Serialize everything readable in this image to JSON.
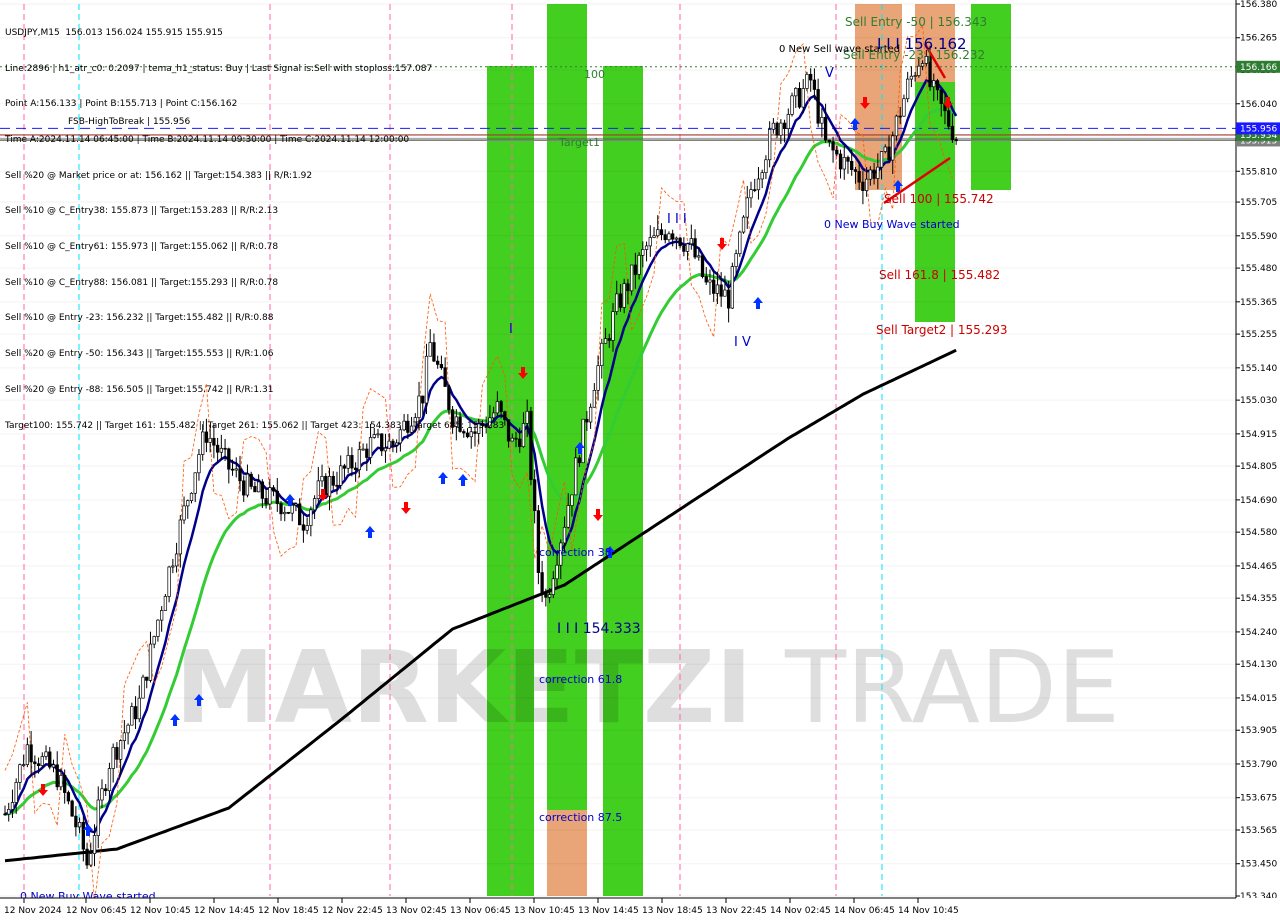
{
  "header": {
    "lines": [
      "USDJPY,M15  156.013 156.024 155.915 155.915",
      "Line:2896 | h1_atr_c0: 0.2097 | tema_h1_status: Buy | Last Signal is:Sell with stoploss:157.087",
      "Point A:156.133 | Point B:155.713 | Point C:156.162",
      "Time A:2024.11.14 06:45:00 | Time B:2024.11.14 09:30:00 | Time C:2024.11.14 12:00:00",
      "Sell %20 @ Market price or at: 156.162 || Target:154.383 || R/R:1.92",
      "Sell %10 @ C_Entry38: 155.873 || Target:153.283 || R/R:2.13",
      "Sell %10 @ C_Entry61: 155.973 || Target:155.062 || R/R:0.78",
      "Sell %10 @ C_Entry88: 156.081 || Target:155.293 || R/R:0.78",
      "Sell %10 @ Entry -23: 156.232 || Target:155.482 || R/R:0.88",
      "Sell %20 @ Entry -50: 156.343 || Target:155.553 || R/R:1.06",
      "Sell %20 @ Entry -88: 156.505 || Target:155.742 || R/R:1.31",
      "Target100: 155.742 || Target 161: 155.482 || Target 261: 155.062 || Target 423: 154.383 || Target 685: 153.283"
    ],
    "overlay": "FSB-HighToBreak | 155.956"
  },
  "watermark": {
    "bold": "MARKETZI",
    "light": "TRADE"
  },
  "chart_data": {
    "type": "candlestick",
    "symbol": "USDJPY",
    "timeframe": "M15",
    "ylim": [
      153.34,
      156.38
    ],
    "y_ticks": [
      "156.380",
      "156.265",
      "156.155",
      "156.040",
      "155.925",
      "155.810",
      "155.705",
      "155.590",
      "155.480",
      "155.365",
      "155.255",
      "155.140",
      "155.030",
      "154.915",
      "154.805",
      "154.690",
      "154.580",
      "154.465",
      "154.355",
      "154.240",
      "154.130",
      "154.015",
      "153.905",
      "153.790",
      "153.675",
      "153.565",
      "153.450",
      "153.340"
    ],
    "x_ticks": [
      "12 Nov 2024",
      "12 Nov 06:45",
      "12 Nov 10:45",
      "12 Nov 14:45",
      "12 Nov 18:45",
      "12 Nov 22:45",
      "13 Nov 02:45",
      "13 Nov 06:45",
      "13 Nov 10:45",
      "13 Nov 14:45",
      "13 Nov 18:45",
      "13 Nov 22:45",
      "14 Nov 02:45",
      "14 Nov 06:45",
      "14 Nov 10:45"
    ],
    "price_keypoints": [
      [
        0,
        153.62
      ],
      [
        6,
        153.85
      ],
      [
        14,
        153.75
      ],
      [
        20,
        153.55
      ],
      [
        22,
        153.45
      ],
      [
        28,
        153.8
      ],
      [
        36,
        154.0
      ],
      [
        44,
        154.45
      ],
      [
        52,
        154.85
      ],
      [
        54,
        154.92
      ],
      [
        60,
        154.8
      ],
      [
        66,
        154.72
      ],
      [
        74,
        154.68
      ],
      [
        80,
        154.62
      ],
      [
        84,
        154.72
      ],
      [
        92,
        154.8
      ],
      [
        98,
        154.88
      ],
      [
        104,
        154.88
      ],
      [
        112,
        155.05
      ],
      [
        114,
        155.22
      ],
      [
        120,
        154.98
      ],
      [
        126,
        154.92
      ],
      [
        132,
        155.0
      ],
      [
        136,
        154.88
      ],
      [
        140,
        154.95
      ],
      [
        143,
        154.45
      ],
      [
        145,
        154.35
      ],
      [
        150,
        154.62
      ],
      [
        158,
        155.1
      ],
      [
        164,
        155.35
      ],
      [
        172,
        155.55
      ],
      [
        178,
        155.62
      ],
      [
        184,
        155.55
      ],
      [
        188,
        155.42
      ],
      [
        194,
        155.38
      ],
      [
        200,
        155.75
      ],
      [
        206,
        155.95
      ],
      [
        212,
        156.05
      ],
      [
        216,
        156.12
      ],
      [
        220,
        155.9
      ],
      [
        224,
        155.85
      ],
      [
        230,
        155.78
      ],
      [
        236,
        155.85
      ],
      [
        242,
        156.1
      ],
      [
        246,
        156.22
      ],
      [
        248,
        156.1
      ],
      [
        252,
        156.0
      ],
      [
        255,
        155.93
      ]
    ],
    "candles": 256,
    "moving_averages": [
      {
        "name": "MA fast",
        "color": "#00008b",
        "smoothing": 8
      },
      {
        "name": "MA mid",
        "color": "#33cc33",
        "smoothing": 24
      },
      {
        "name": "MA slow",
        "color": "#000000",
        "keypoints": [
          [
            0,
            153.46
          ],
          [
            30,
            153.5
          ],
          [
            60,
            153.64
          ],
          [
            90,
            153.94
          ],
          [
            120,
            154.25
          ],
          [
            150,
            154.4
          ],
          [
            180,
            154.65
          ],
          [
            210,
            154.9
          ],
          [
            230,
            155.05
          ],
          [
            255,
            155.2
          ]
        ]
      }
    ],
    "price_lines": [
      {
        "name": "current price",
        "value": 155.915,
        "label": "155.915",
        "color": "#808080"
      },
      {
        "name": "C_Entry38",
        "value": 155.934,
        "label": "155.934",
        "color": "#2e7d32"
      },
      {
        "name": "FSB-HighToBreak",
        "value": 155.956,
        "label": "155.956",
        "color": "#1a1aff",
        "dashed": true
      },
      {
        "name": "upper target",
        "value": 156.166,
        "label": "156.166",
        "color": "#2e7d32",
        "dotted": true
      }
    ],
    "annotations": [
      {
        "name": "sell-entry-50",
        "text": "Sell Entry -50 | 156.343",
        "color": "#2e7d32"
      },
      {
        "name": "sell-entry-23",
        "text": "Sell Entry -23 | 156.232",
        "color": "#2e7d32"
      },
      {
        "name": "point-c",
        "text": "I I I 156.162",
        "color": "#00008b"
      },
      {
        "name": "sell-wave",
        "text": "0 New Sell wave started",
        "color": "#000000"
      },
      {
        "name": "sell-100",
        "text": "Sell 100 | 155.742",
        "color": "#cc0000"
      },
      {
        "name": "sell-161",
        "text": "Sell 161.8 | 155.482",
        "color": "#cc0000"
      },
      {
        "name": "sell-target2",
        "text": "Sell Target2 | 155.293",
        "color": "#cc0000"
      },
      {
        "name": "buy-wave-right",
        "text": "0 New Buy Wave started",
        "color": "#0000cc"
      },
      {
        "name": "buy-wave-left",
        "text": "0 New Buy Wave started",
        "color": "#0000cc"
      },
      {
        "name": "point-low",
        "text": "I I I 154.333",
        "color": "#00008b"
      },
      {
        "name": "correction-38",
        "text": "correction 38",
        "color": "#0000cc"
      },
      {
        "name": "correction-61",
        "text": "correction 61.8",
        "color": "#0000cc"
      },
      {
        "name": "correction-87",
        "text": "correction 87.5",
        "color": "#0000cc"
      },
      {
        "name": "label-100",
        "text": "100",
        "color": "#2e7d32"
      },
      {
        "name": "label-target1",
        "text": "Target1",
        "color": "#2e7d32"
      },
      {
        "name": "wave-iii",
        "text": "I I I",
        "color": "#0000cc"
      },
      {
        "name": "wave-iv",
        "text": "I V",
        "color": "#0000cc"
      },
      {
        "name": "wave-i",
        "text": "I",
        "color": "#0000cc"
      },
      {
        "name": "wave-v",
        "text": "V",
        "color": "#0000cc"
      }
    ]
  }
}
